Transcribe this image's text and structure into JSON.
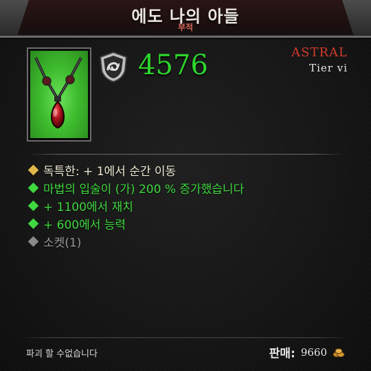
{
  "item": {
    "name": "에도 나의 아들",
    "type": "부적",
    "rarity": "ASTRAL",
    "tier": "Tier vi",
    "stat_value": "4576",
    "stat_icon": "attack-shield-icon",
    "image": "amulet-icon"
  },
  "affixes": [
    {
      "kind": "unique",
      "text": "독특한: + 1에서 순간 이동"
    },
    {
      "kind": "magic",
      "text": "마법의 입술이 (가) 200 % 증가했습니다"
    },
    {
      "kind": "magic",
      "text": "+ 1100에서 재치"
    },
    {
      "kind": "magic",
      "text": "+ 600에서 능력"
    },
    {
      "kind": "socket",
      "text": "소켓(1)"
    }
  ],
  "footer": {
    "note": "파괴 할 수없습니다",
    "sell_label": "판매:",
    "sell_value": "9660",
    "currency_icon": "gold-coins-icon"
  },
  "colors": {
    "rarity": "#d23a2a",
    "stat": "#2dd52d",
    "magic_affix": "#3fd83f",
    "unique_bullet": "#e0b84a",
    "item_background": "#3fbd2e"
  }
}
